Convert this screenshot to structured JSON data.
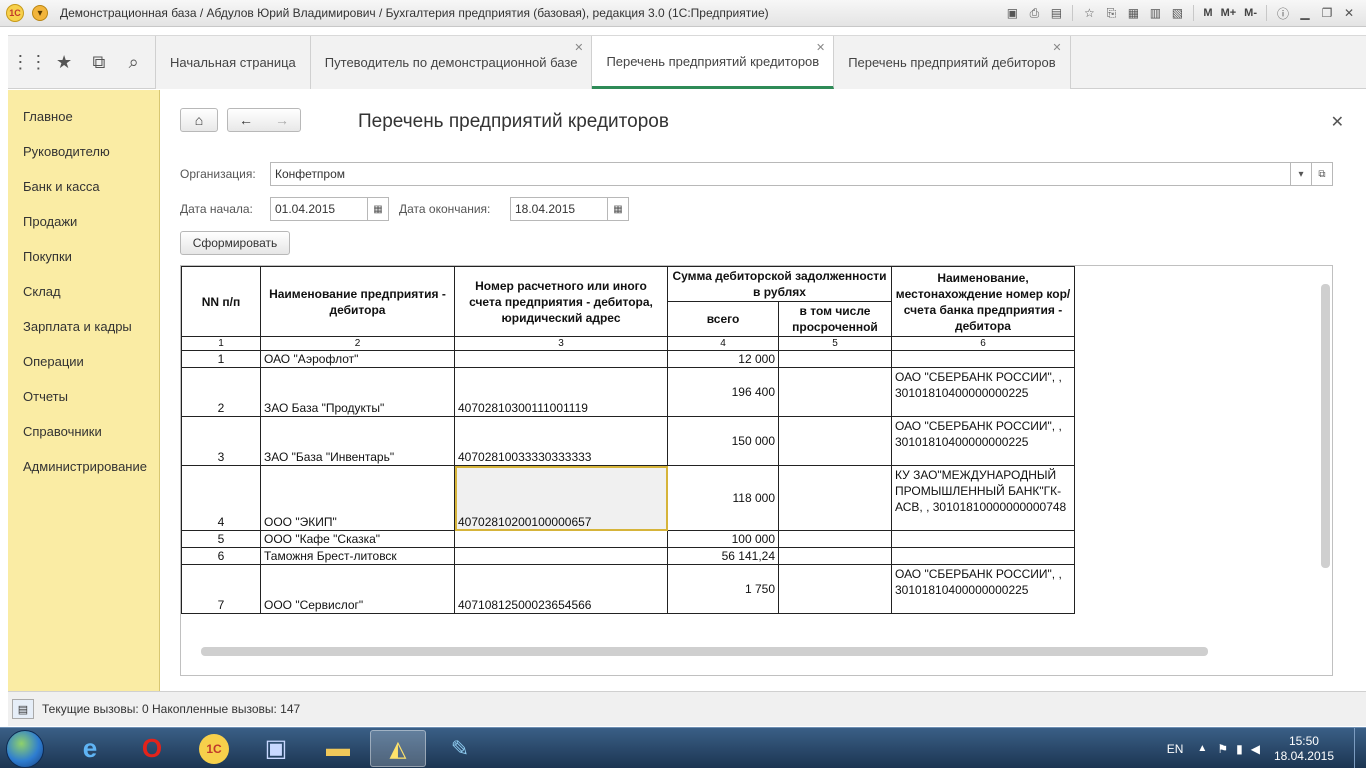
{
  "window": {
    "title": "Демонстрационная база / Абдулов Юрий Владимирович / Бухгалтерия предприятия (базовая), редакция 3.0  (1С:Предприятие)",
    "logo_text": "1С",
    "toolbar_right": [
      "M",
      "M+",
      "M-"
    ]
  },
  "tabs": [
    {
      "label": "Начальная страница",
      "active": false,
      "closable": false
    },
    {
      "label": "Путеводитель по демонстрационной базе",
      "active": false,
      "closable": true
    },
    {
      "label": "Перечень предприятий кредиторов",
      "active": true,
      "closable": true
    },
    {
      "label": "Перечень предприятий дебиторов",
      "active": false,
      "closable": true
    }
  ],
  "sidebar": {
    "items": [
      {
        "label": "Главное"
      },
      {
        "label": "Руководителю"
      },
      {
        "label": "Банк и касса"
      },
      {
        "label": "Продажи"
      },
      {
        "label": "Покупки"
      },
      {
        "label": "Склад"
      },
      {
        "label": "Зарплата и кадры"
      },
      {
        "label": "Операции"
      },
      {
        "label": "Отчеты"
      },
      {
        "label": "Справочники"
      },
      {
        "label": "Администрирование"
      }
    ]
  },
  "form": {
    "title": "Перечень предприятий кредиторов",
    "org_label": "Организация:",
    "org_value": "Конфетпром",
    "start_label": "Дата начала:",
    "start_value": "01.04.2015",
    "end_label": "Дата окончания:",
    "end_value": "18.04.2015",
    "generate_label": "Сформировать"
  },
  "report": {
    "headers": {
      "nn": "NN п/п",
      "name": "Наименование предприятия - дебитора",
      "account": "Номер расчетного или иного счета предприятия - дебитора, юридический адрес",
      "sum": "Сумма дебиторской задолженности в рублях",
      "total": "всего",
      "overdue": "в том числе просроченной",
      "bank": "Наименование, местонахождение номер кор/счета банка предприятия - дебитора"
    },
    "col_numbers": [
      "1",
      "2",
      "3",
      "4",
      "5",
      "6"
    ],
    "rows": [
      {
        "nn": "1",
        "name": "ОАО \"Аэрофлот\"",
        "account": "",
        "total": "12 000",
        "overdue": "",
        "bank": ""
      },
      {
        "nn": "2",
        "name": "ЗАО База \"Продукты\"",
        "account": "40702810300111001119",
        "total": "196 400",
        "overdue": "",
        "bank": "ОАО \"СБЕРБАНК РОССИИ\", , 30101810400000000225"
      },
      {
        "nn": "3",
        "name": "ЗАО \"База \"Инвентарь\"",
        "account": "40702810033330333333",
        "total": "150 000",
        "overdue": "",
        "bank": "ОАО \"СБЕРБАНК РОССИИ\", , 30101810400000000225"
      },
      {
        "nn": "4",
        "name": "ООО \"ЭКИП\"",
        "account": "40702810200100000657",
        "total": "118 000",
        "overdue": "",
        "bank": "КУ ЗАО\"МЕЖДУНАРОДНЫЙ ПРОМЫШЛЕННЫЙ БАНК\"ГК-АСВ, , 30101810000000000748"
      },
      {
        "nn": "5",
        "name": "ООО \"Кафе \"Сказка\"",
        "account": "",
        "total": "100 000",
        "overdue": "",
        "bank": ""
      },
      {
        "nn": "6",
        "name": "Таможня Брест-литовск",
        "account": "",
        "total": "56 141,24",
        "overdue": "",
        "bank": ""
      },
      {
        "nn": "7",
        "name": "ООО \"Сервислог\"",
        "account": "40710812500023654566",
        "total": "1 750",
        "overdue": "",
        "bank": "ОАО \"СБЕРБАНК РОССИИ\", , 30101810400000000225"
      }
    ]
  },
  "status": {
    "text": "Текущие вызовы: 0    Накопленные вызовы: 147"
  },
  "taskbar": {
    "lang": "EN",
    "time": "15:50",
    "date": "18.04.2015"
  }
}
